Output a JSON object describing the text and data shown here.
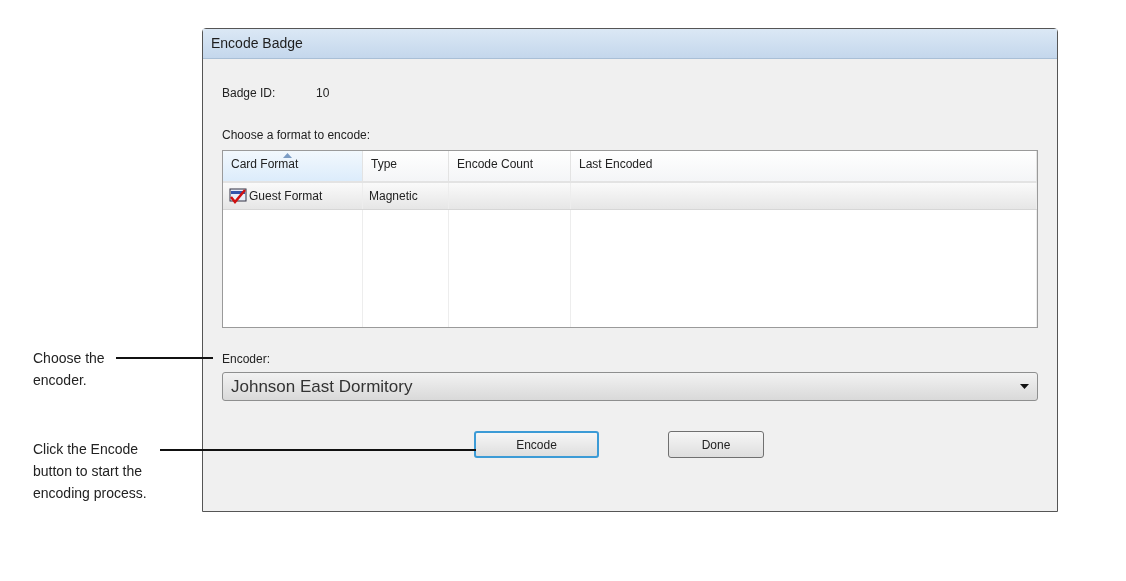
{
  "window": {
    "title": "Encode Badge"
  },
  "badge_id": {
    "label": "Badge ID:",
    "value": "10"
  },
  "format_prompt": "Choose a format to encode:",
  "table": {
    "columns": [
      {
        "label": "Card Format",
        "sorted": true
      },
      {
        "label": "Type",
        "sorted": false
      },
      {
        "label": "Encode Count",
        "sorted": false
      },
      {
        "label": "Last Encoded",
        "sorted": false
      }
    ],
    "rows": [
      {
        "cells": [
          "Guest Format",
          "Magnetic",
          "",
          ""
        ],
        "selected": true
      }
    ]
  },
  "encoder": {
    "label": "Encoder:",
    "value": "Johnson East Dormitory"
  },
  "buttons": [
    {
      "label": "Encode",
      "default": true
    },
    {
      "label": "Done",
      "default": false
    }
  ],
  "annotations": [
    {
      "text": "Choose the encoder."
    },
    {
      "text": "Click the Encode button to start the encoding process."
    }
  ]
}
